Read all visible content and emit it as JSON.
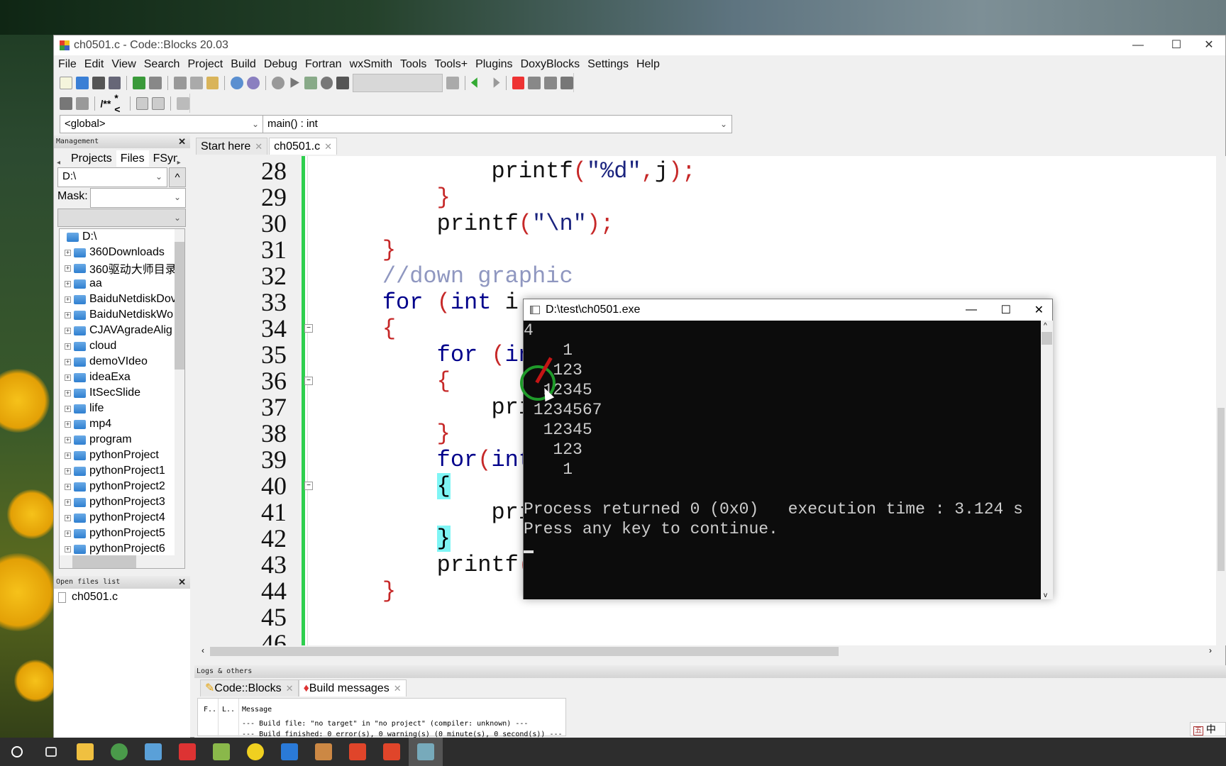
{
  "window": {
    "title": "ch0501.c - Code::Blocks 20.03"
  },
  "menu": [
    "File",
    "Edit",
    "View",
    "Search",
    "Project",
    "Build",
    "Debug",
    "Fortran",
    "wxSmith",
    "Tools",
    "Tools+",
    "Plugins",
    "DoxyBlocks",
    "Settings",
    "Help"
  ],
  "toolbar2": {
    "doxy1": "/**",
    "doxy2": "*<"
  },
  "scope": {
    "left": "<global>",
    "right": "main() : int"
  },
  "management": {
    "title": "Management",
    "tabs": [
      "Projects",
      "Files",
      "FSyn"
    ],
    "drive": "D:\\",
    "mask_label": "Mask:",
    "mask_value": "",
    "tree_root": "D:\\",
    "tree": [
      "360Downloads",
      "360驱动大师目录",
      "aa",
      "BaiduNetdiskDov",
      "BaiduNetdiskWo",
      "CJAVAgradeAlig",
      "cloud",
      "demoVIdeo",
      "ideaExa",
      "ItSecSlide",
      "life",
      "mp4",
      "program",
      "pythonProject",
      "pythonProject1",
      "pythonProject2",
      "pythonProject3",
      "pythonProject4",
      "pythonProject5",
      "pythonProject6"
    ]
  },
  "open_files": {
    "title": "Open files list",
    "items": [
      "ch0501.c"
    ]
  },
  "editor_tabs": [
    {
      "label": "Start here",
      "active": false
    },
    {
      "label": "ch0501.c",
      "active": true
    }
  ],
  "code": [
    {
      "n": "28",
      "t": [
        [
          "            ",
          "tx"
        ],
        [
          "printf",
          "tx"
        ],
        [
          "(",
          "br"
        ],
        [
          "\"%d\"",
          "st"
        ],
        [
          ",",
          "br"
        ],
        [
          "j",
          "tx"
        ],
        [
          ")",
          "br"
        ],
        [
          ";",
          "br"
        ]
      ]
    },
    {
      "n": "29",
      "t": [
        [
          "        ",
          "tx"
        ],
        [
          "}",
          "br"
        ]
      ]
    },
    {
      "n": "30",
      "t": [
        [
          "        ",
          "tx"
        ],
        [
          "printf",
          "tx"
        ],
        [
          "(",
          "br"
        ],
        [
          "\"\\n\"",
          "st"
        ],
        [
          ")",
          "br"
        ],
        [
          ";",
          "br"
        ]
      ]
    },
    {
      "n": "31",
      "t": [
        [
          "    ",
          "tx"
        ],
        [
          "}",
          "br"
        ]
      ]
    },
    {
      "n": "32",
      "t": [
        [
          "    ",
          "tx"
        ],
        [
          "//down graphic",
          "cm"
        ]
      ]
    },
    {
      "n": "33",
      "t": [
        [
          "    ",
          "tx"
        ],
        [
          "for",
          "kw"
        ],
        [
          " ",
          "tx"
        ],
        [
          "(",
          "br"
        ],
        [
          "int",
          "kw"
        ],
        [
          " i",
          "tx"
        ]
      ]
    },
    {
      "n": "34",
      "t": [
        [
          "    ",
          "tx"
        ],
        [
          "{",
          "br"
        ]
      ]
    },
    {
      "n": "35",
      "t": [
        [
          "        ",
          "tx"
        ],
        [
          "for",
          "kw"
        ],
        [
          " ",
          "tx"
        ],
        [
          "(",
          "br"
        ],
        [
          "in",
          "kw"
        ]
      ]
    },
    {
      "n": "36",
      "t": [
        [
          "        ",
          "tx"
        ],
        [
          "{",
          "br"
        ]
      ]
    },
    {
      "n": "37",
      "t": [
        [
          "            ",
          "tx"
        ],
        [
          "pri",
          "tx"
        ]
      ]
    },
    {
      "n": "38",
      "t": [
        [
          "        ",
          "tx"
        ],
        [
          "}",
          "br"
        ]
      ]
    },
    {
      "n": "39",
      "t": [
        [
          "        ",
          "tx"
        ],
        [
          "for",
          "kw"
        ],
        [
          "(",
          "br"
        ],
        [
          "int",
          "kw"
        ]
      ]
    },
    {
      "n": "40",
      "t": [
        [
          "        ",
          "tx"
        ],
        [
          "{",
          "hl"
        ]
      ]
    },
    {
      "n": "41",
      "t": [
        [
          "            ",
          "tx"
        ],
        [
          "pri",
          "tx"
        ]
      ]
    },
    {
      "n": "42",
      "t": [
        [
          "        ",
          "tx"
        ],
        [
          "}",
          "hl"
        ]
      ]
    },
    {
      "n": "43",
      "t": [
        [
          "        ",
          "tx"
        ],
        [
          "printf",
          "tx"
        ],
        [
          "(",
          "br"
        ]
      ]
    },
    {
      "n": "44",
      "t": [
        [
          "    ",
          "tx"
        ],
        [
          "}",
          "br"
        ]
      ]
    },
    {
      "n": "45",
      "t": []
    },
    {
      "n": "46",
      "t": []
    }
  ],
  "logs": {
    "title": "Logs & others",
    "tabs": [
      {
        "label": "Code::Blocks"
      },
      {
        "label": "Build messages"
      }
    ],
    "columns": [
      "F..",
      "L..",
      "Message"
    ],
    "messages": [
      "--- Build file: \"no target\" in \"no project\" (compiler: unknown) ---",
      "--- Build finished: 0 error(s), 0 warning(s) (0 minute(s), 0 second(s)) ---"
    ]
  },
  "console": {
    "title": "D:\\test\\ch0501.exe",
    "lines": [
      "4",
      "    1",
      "   123",
      "  12345",
      " 1234567",
      "  12345",
      "   123",
      "    1",
      "",
      "Process returned 0 (0x0)   execution time : 3.124 s",
      "Press any key to continue."
    ]
  },
  "ime": {
    "label": "中"
  },
  "taskbar": {
    "icons": [
      "search-icon",
      "task-view-icon",
      "file-explorer-icon",
      "chrome-icon",
      "app-icon",
      "wps-icon",
      "notepad-icon",
      "music-icon",
      "video-icon",
      "codeblocks-icon",
      "wps-writer-icon",
      "wps-writer-icon",
      "console-icon"
    ]
  }
}
